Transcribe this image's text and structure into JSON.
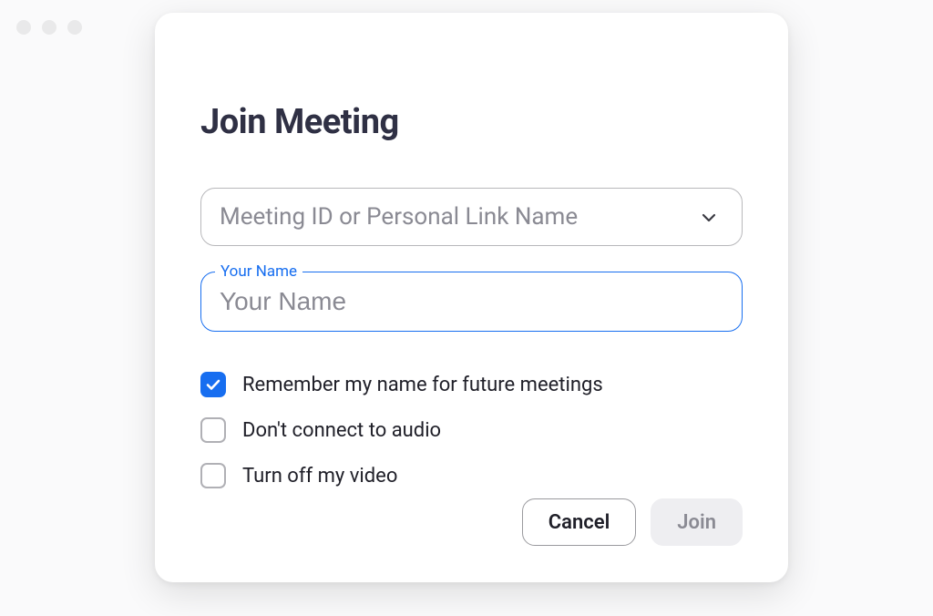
{
  "dialog": {
    "title": "Join Meeting",
    "meeting_id": {
      "placeholder": "Meeting ID or Personal Link Name"
    },
    "name_field": {
      "label": "Your Name",
      "placeholder": "Your Name",
      "value": ""
    },
    "options": {
      "remember_name": {
        "label": "Remember my name for future meetings",
        "checked": true
      },
      "no_audio": {
        "label": "Don't connect to audio",
        "checked": false
      },
      "video_off": {
        "label": "Turn off my video",
        "checked": false
      }
    },
    "buttons": {
      "cancel": "Cancel",
      "join": "Join"
    }
  },
  "colors": {
    "accent": "#176ef0",
    "text_dark": "#2f3044",
    "text_body": "#1f1f28",
    "text_muted": "#8a8a93",
    "border": "#b8b8bb",
    "disabled_bg": "#eeeef1"
  }
}
